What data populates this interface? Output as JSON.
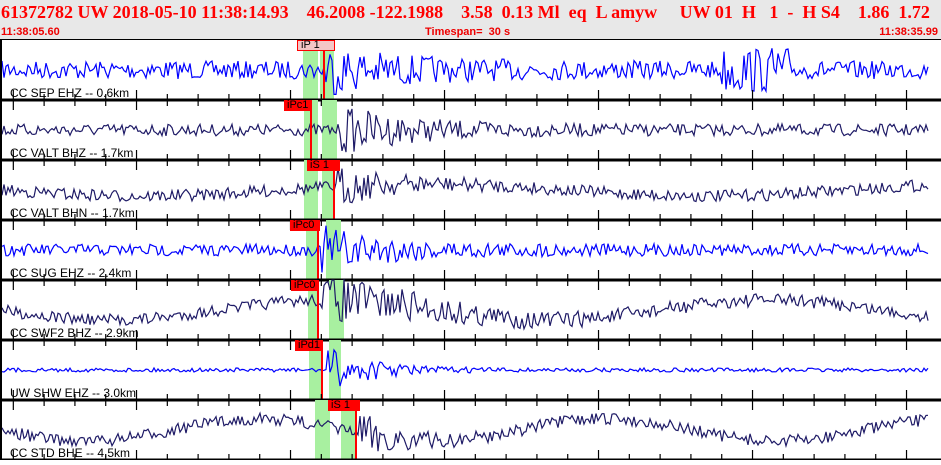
{
  "header": {
    "title": "61372782 UW 2018-05-10 11:38:14.93    46.2008 -122.1988    3.58  0.13 Ml  eq  L amyw     UW 01  H   1  -  H S4    1.86  1.72",
    "start_time": "11:38:05.60",
    "timespan": "Timespan=  30 s",
    "end_time": "11:38:35.99",
    "color": "#ff0000"
  },
  "colors": {
    "blue_trace": "#0000ff",
    "navy_trace": "#1e1a66",
    "pick": "#ff0000",
    "pick_selected_bg": "#f4c6c6",
    "window": "#a8f0a0"
  },
  "traces": [
    {
      "label": "CC SEP EHZ -- 0.6km",
      "color": "blue",
      "pick": "iP 1",
      "selected": true
    },
    {
      "label": "CC VALT BHZ -- 1.7km",
      "color": "navy",
      "pick": "iPc1"
    },
    {
      "label": "CC VALT BHN -- 1.7km",
      "color": "navy",
      "pick": "iS 1"
    },
    {
      "label": "CC SUG EHZ -- 2.4km",
      "color": "blue",
      "pick": "iPc0"
    },
    {
      "label": "CC SWF2 BHZ -- 2.9km",
      "color": "navy",
      "pick": "iPc0"
    },
    {
      "label": "UW SHW EHZ -- 3.0km",
      "color": "blue",
      "pick": "iPd1"
    },
    {
      "label": "CC STD BHE -- 4.5km",
      "color": "navy",
      "pick": "iS 1"
    }
  ]
}
